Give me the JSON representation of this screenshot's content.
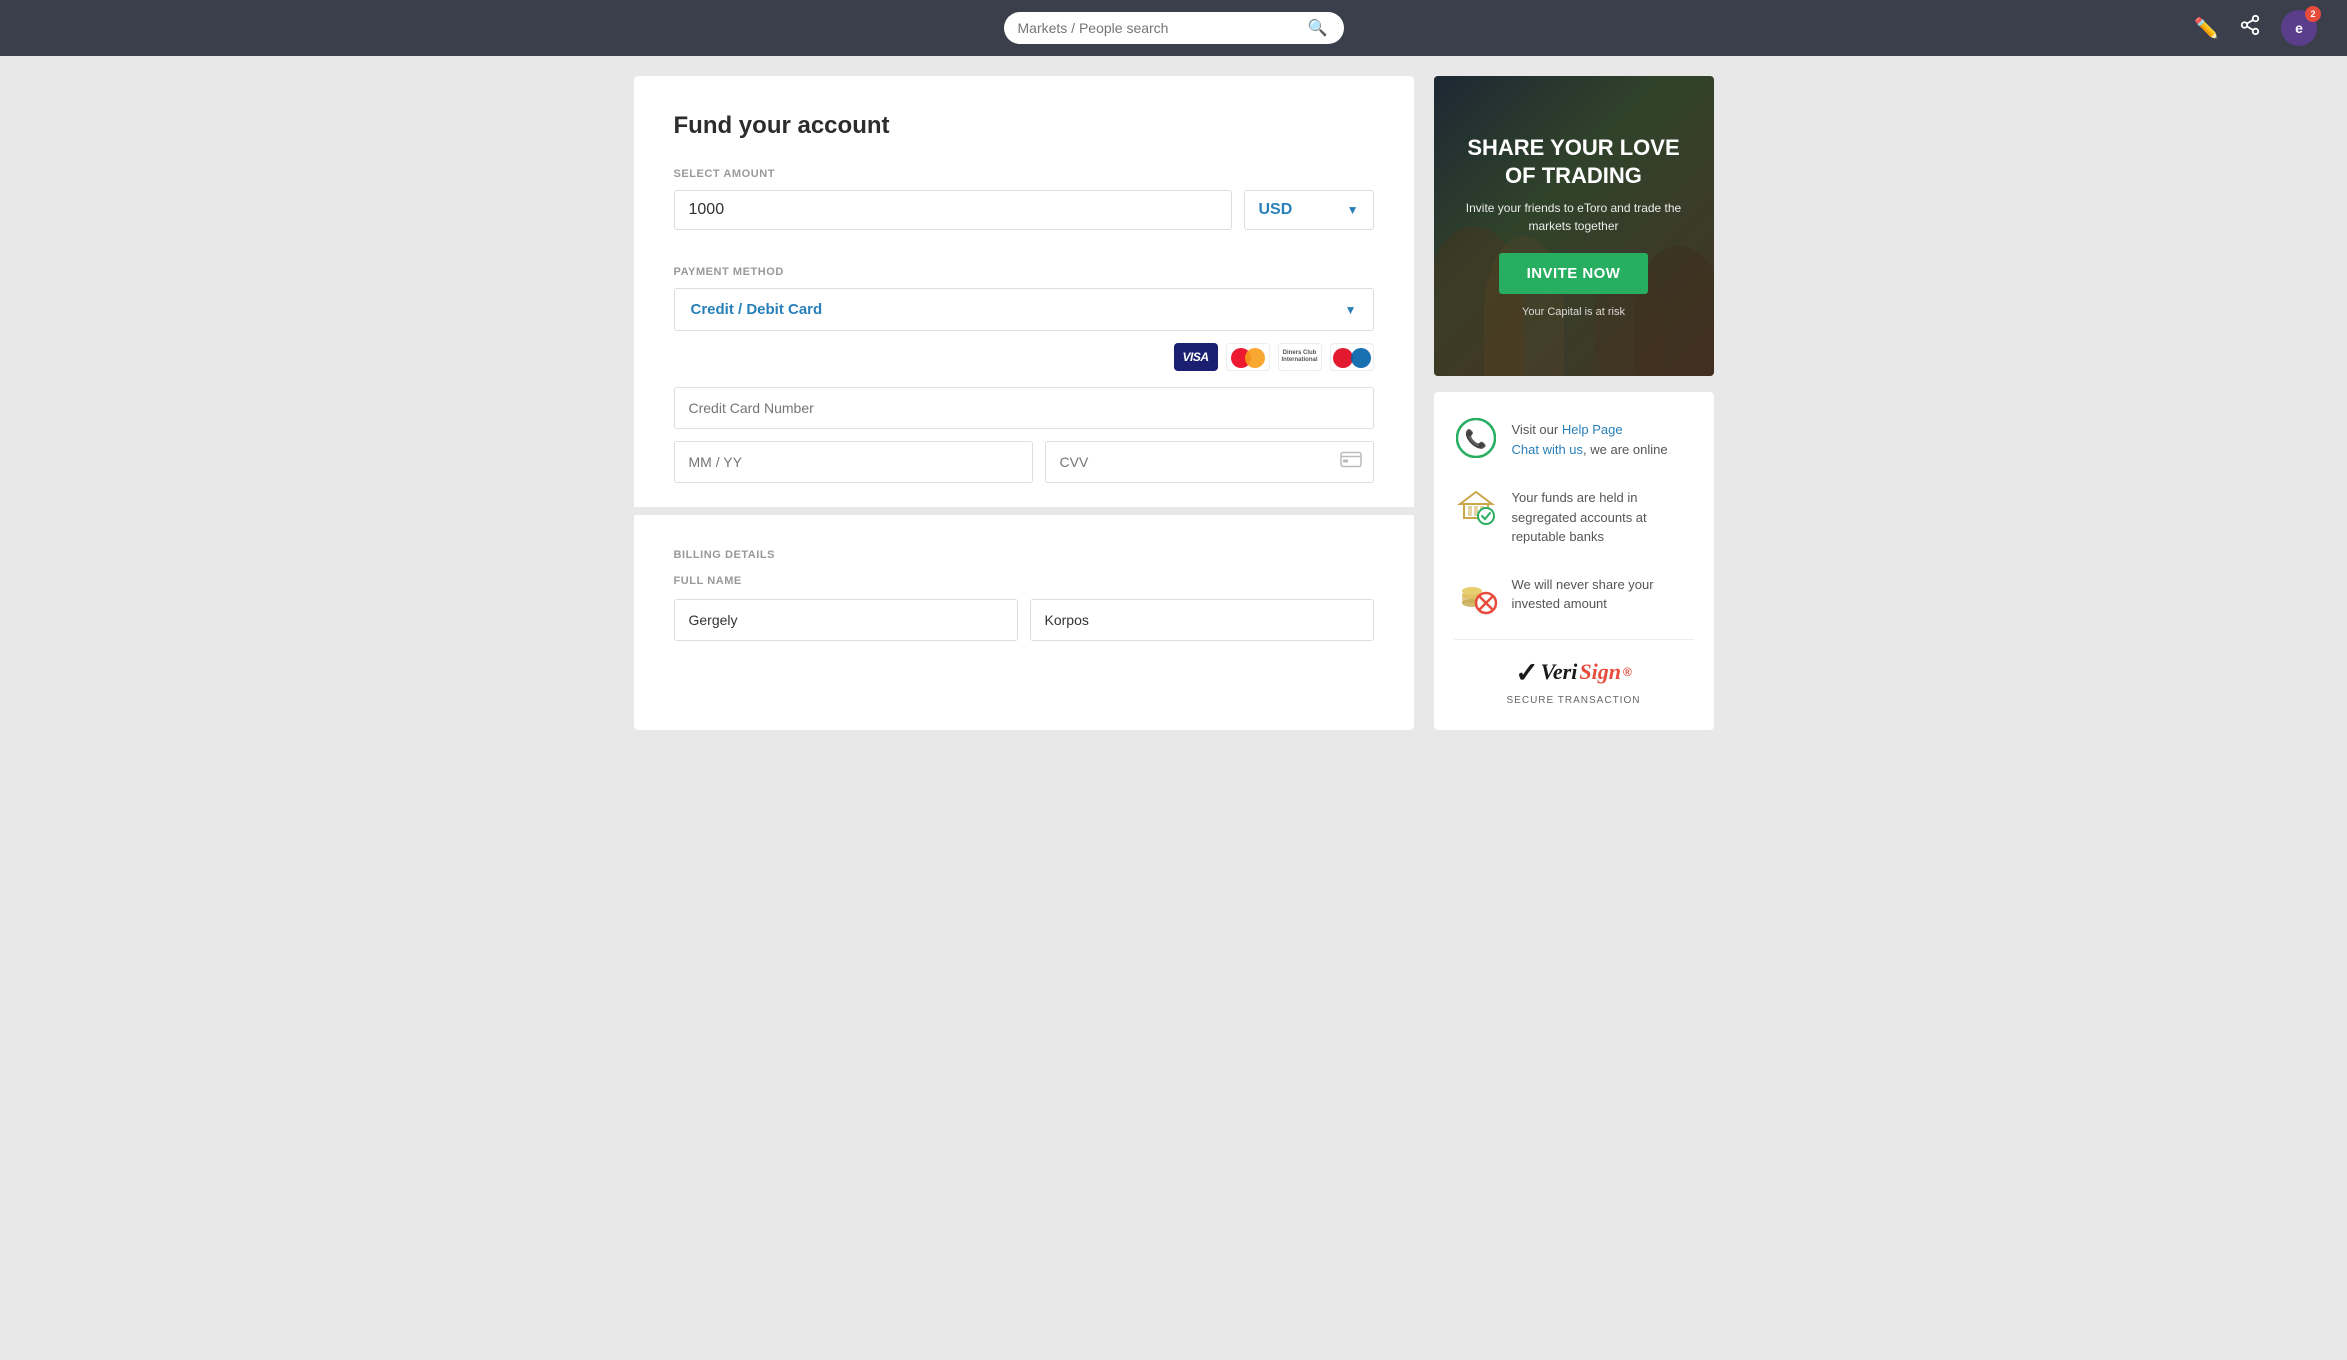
{
  "topbar": {
    "search_placeholder": "Markets / People search",
    "avatar_letter": "e",
    "badge_count": "2"
  },
  "fund_form": {
    "title": "Fund your account",
    "amount_section_label": "SELECT AMOUNT",
    "amount_value": "1000",
    "currency_value": "USD",
    "payment_section_label": "PAYMENT METHOD",
    "payment_method": "Credit / Debit Card",
    "card_number_placeholder": "Credit Card Number",
    "mm_yy_placeholder": "MM / YY",
    "cvv_placeholder": "CVV",
    "billing_section_label": "BILLING DETAILS",
    "full_name_label": "FULL NAME",
    "first_name_value": "Gergely",
    "last_name_value": "Korpos"
  },
  "banner": {
    "title": "SHARE YOUR LOVE\nOF TRADING",
    "subtitle": "Invite your friends to eToro\nand trade the markets together",
    "invite_btn_label": "INVITE NOW",
    "capital_risk": "Your Capital is at risk"
  },
  "info_card": {
    "items": [
      {
        "id": "help",
        "text_before": "Visit our ",
        "link1": "Help Page",
        "text_middle": "\nChat with us",
        "link2": "",
        "text_after": ", we are\nonline"
      },
      {
        "id": "bank",
        "text": "Your funds are held in segregated accounts at reputable banks"
      },
      {
        "id": "coins",
        "text": "We will never share your invested amount"
      }
    ],
    "verisign_label": "VeriSign",
    "secure_label": "SECURE TRANSACTION"
  }
}
